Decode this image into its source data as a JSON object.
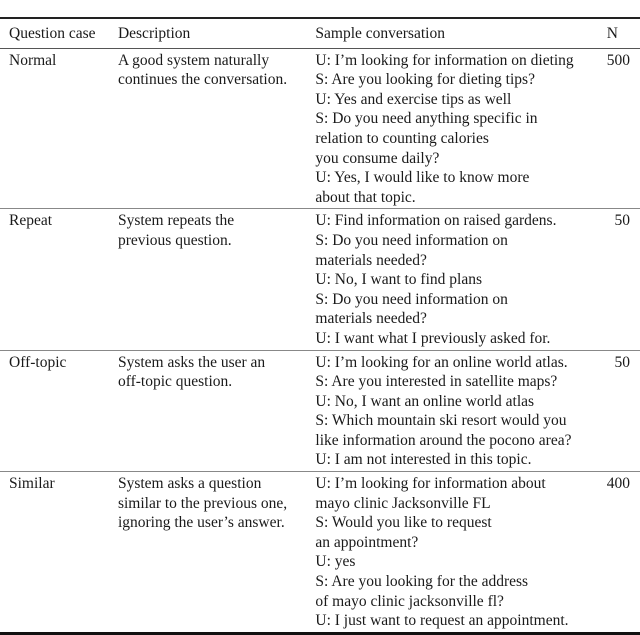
{
  "table": {
    "headers": {
      "question_case": "Question case",
      "description": "Description",
      "sample_conversation": "Sample conversation",
      "n": "N"
    },
    "rows": [
      {
        "question_case": "Normal",
        "description_lines": [
          "A good system naturally",
          "continues the conversation."
        ],
        "conversation_lines": [
          "U: I’m looking for information on dieting",
          "S: Are you looking for dieting tips?",
          "U: Yes and exercise tips as well",
          "S: Do you need anything specific in",
          "relation to counting calories",
          "you consume daily?",
          "U: Yes, I would like to know more",
          "about that topic."
        ],
        "n": "500"
      },
      {
        "question_case": "Repeat",
        "description_lines": [
          "System repeats the",
          "previous question."
        ],
        "conversation_lines": [
          "U: Find information on raised gardens.",
          "S: Do you need information on",
          "materials needed?",
          "U: No, I want to find plans",
          "S: Do you need information on",
          "materials needed?",
          "U: I want what I previously asked for."
        ],
        "n": "50"
      },
      {
        "question_case": "Off-topic",
        "description_lines": [
          "System asks the user an",
          "off-topic question."
        ],
        "conversation_lines": [
          "U: I’m looking for an online world atlas.",
          "S: Are you interested in satellite maps?",
          "U: No, I want an online world atlas",
          "S: Which mountain ski resort would you",
          "like information around the pocono area?",
          "U: I am not interested in this topic."
        ],
        "n": "50"
      },
      {
        "question_case": "Similar",
        "description_lines": [
          "System asks a question",
          "similar to the previous one,",
          "ignoring the user’s answer."
        ],
        "conversation_lines": [
          "U: I’m looking for information about",
          "mayo clinic Jacksonville FL",
          "S: Would you like to request",
          "an appointment?",
          "U: yes",
          "S: Are you looking for the address",
          "of mayo clinic jacksonville fl?",
          "U: I just want to request an appointment."
        ],
        "n": "400"
      }
    ]
  }
}
